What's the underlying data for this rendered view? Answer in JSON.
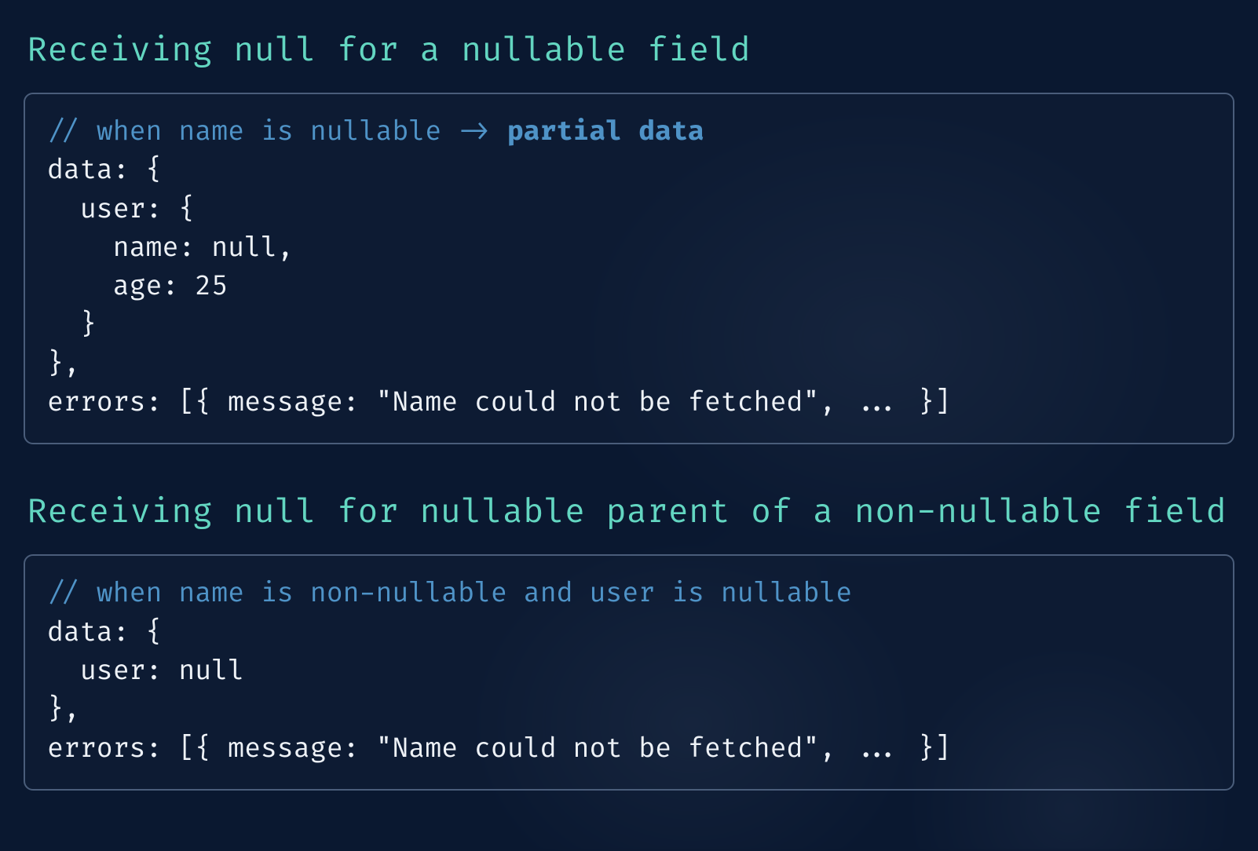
{
  "sections": [
    {
      "heading": "Receiving null for a nullable field",
      "code": {
        "comment_prefix": "// when name is nullable -> ",
        "comment_emph": "partial data",
        "body": "data: {\n  user: {\n    name: null,\n    age: 25\n  }\n},\nerrors: [{ message: \"Name could not be fetched\", ... }]"
      }
    },
    {
      "heading": "Receiving null for nullable parent of a non-nullable field",
      "code": {
        "comment_prefix": "// when name is non-nullable and user is nullable",
        "comment_emph": "",
        "body": "data: {\n  user: null\n},\nerrors: [{ message: \"Name could not be fetched\", ... }]"
      }
    }
  ]
}
